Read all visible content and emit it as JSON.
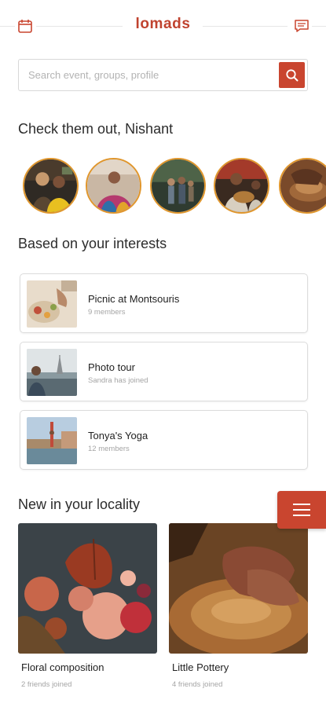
{
  "header": {
    "brand": "lomads",
    "left_icon": "calendar-icon",
    "right_icon": "chat-icon"
  },
  "search": {
    "placeholder": "Search event, groups, profile",
    "icon": "search-icon"
  },
  "sections": {
    "check_out": "Check them out, Nishant",
    "interests": "Based on your interests",
    "locality": "New in your locality"
  },
  "profiles": [
    {
      "label": "profile-1"
    },
    {
      "label": "profile-2"
    },
    {
      "label": "profile-3"
    },
    {
      "label": "profile-4"
    },
    {
      "label": "profile-5"
    }
  ],
  "interests": [
    {
      "title": "Picnic at Montsouris",
      "subtitle": "9 members"
    },
    {
      "title": "Photo tour",
      "subtitle": "Sandra has joined"
    },
    {
      "title": "Tonya's Yoga",
      "subtitle": "12 members"
    }
  ],
  "locality": [
    {
      "title": "Floral composition",
      "subtitle": "2 friends joined"
    },
    {
      "title": "Little Pottery",
      "subtitle": "4 friends joined"
    }
  ],
  "colors": {
    "accent": "#c9452f",
    "ring": "#e0962c"
  },
  "menu_icon": "hamburger-menu-icon"
}
